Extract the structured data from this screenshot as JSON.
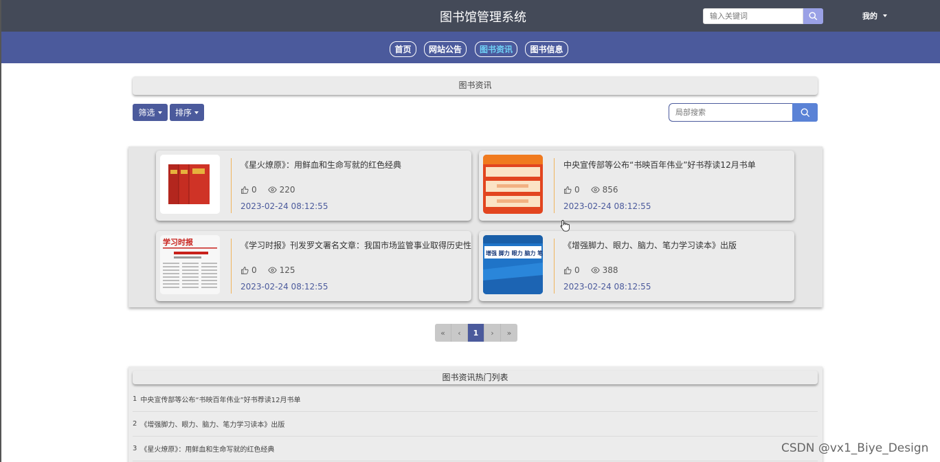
{
  "header": {
    "title": "图书馆管理系统",
    "search_placeholder": "输入关键词",
    "user_menu": "我的"
  },
  "nav": {
    "items": [
      {
        "label": "首页",
        "active": false
      },
      {
        "label": "网站公告",
        "active": false
      },
      {
        "label": "图书资讯",
        "active": true
      },
      {
        "label": "图书信息",
        "active": false
      }
    ]
  },
  "section": {
    "title": "图书资讯",
    "filter_label": "筛选",
    "sort_label": "排序",
    "local_search_placeholder": "局部搜索"
  },
  "articles": [
    {
      "title": "《星火燎原》：用鲜血和生命写就的红色经典",
      "likes": "0",
      "views": "220",
      "date": "2023-02-24 08:12:55",
      "thumb": "red-books"
    },
    {
      "title": "中央宣传部等公布“书映百年伟业”好书荐读12月书单",
      "likes": "0",
      "views": "856",
      "date": "2023-02-24 08:12:55",
      "thumb": "orange-banner"
    },
    {
      "title": "《学习时报》刊发罗文署名文章：我国市场监管事业取得历史性成",
      "likes": "0",
      "views": "125",
      "date": "2023-02-24 08:12:55",
      "thumb": "newspaper"
    },
    {
      "title": "《增强脚力、眼力、脑力、笔力学习读本》出版",
      "likes": "0",
      "views": "388",
      "date": "2023-02-24 08:12:55",
      "thumb": "blue-book"
    }
  ],
  "thumb_text": {
    "newspaper_masthead": "学习时报",
    "blue_book_cover": "增强 脚力 眼力 脑力 笔力 学习读本"
  },
  "pagination": {
    "first": "«",
    "prev": "‹",
    "current": "1",
    "next": "›",
    "last": "»"
  },
  "hot_list": {
    "title": "图书资讯热门列表",
    "items": [
      {
        "rank": "1",
        "title": "中央宣传部等公布“书映百年伟业”好书荐读12月书单"
      },
      {
        "rank": "2",
        "title": "《增强脚力、眼力、脑力、笔力学习读本》出版"
      },
      {
        "rank": "3",
        "title": "《星火燎原》：用鲜血和生命写就的红色经典"
      }
    ]
  },
  "watermark": "CSDN @vx1_Biye_Design",
  "colors": {
    "topbar": "#444a58",
    "navbar": "#4b5a9c",
    "accent": "#4b5a9c",
    "active_nav_text": "#6fd0f5",
    "separator": "#f0b35c"
  }
}
